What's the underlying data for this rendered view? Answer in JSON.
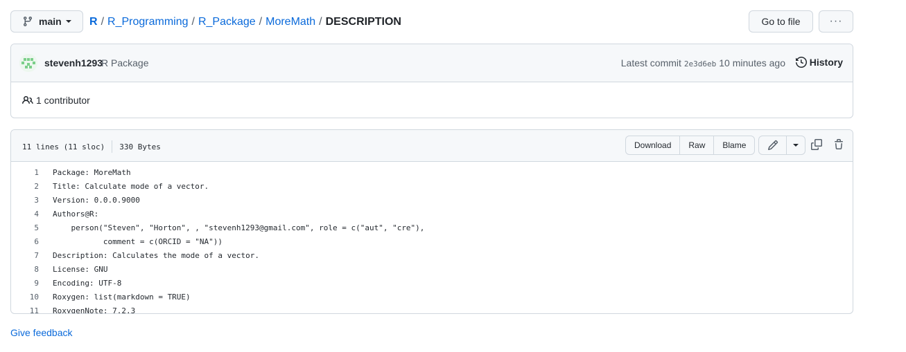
{
  "branch": {
    "label": "main"
  },
  "breadcrumb": {
    "items": [
      "R",
      "R_Programming",
      "R_Package",
      "MoreMath"
    ],
    "current": "DESCRIPTION",
    "separator": "/"
  },
  "toolbar": {
    "goto_label": "Go to file",
    "more_label": "···"
  },
  "commit": {
    "author": "stevenh1293",
    "message": "R Package",
    "latest_label": "Latest commit",
    "sha": "2e3d6eb",
    "time": "10 minutes ago",
    "history_label": "History"
  },
  "contributors": {
    "label": "1 contributor"
  },
  "file": {
    "lines_info": "11 lines (11 sloc)",
    "size": "330 Bytes",
    "buttons": {
      "download": "Download",
      "raw": "Raw",
      "blame": "Blame"
    },
    "lines": [
      "Package: MoreMath",
      "Title: Calculate mode of a vector.",
      "Version: 0.0.0.9000",
      "Authors@R:",
      "    person(\"Steven\", \"Horton\", , \"stevenh1293@gmail.com\", role = c(\"aut\", \"cre\"),",
      "           comment = c(ORCID = \"NA\"))",
      "Description: Calculates the mode of a vector.",
      "License: GNU",
      "Encoding: UTF-8",
      "Roxygen: list(markdown = TRUE)",
      "RoxygenNote: 7.2.3"
    ]
  },
  "feedback": {
    "label": "Give feedback"
  },
  "colors": {
    "link": "#0969da",
    "border": "#d0d7de",
    "header_bg": "#f6f8fa",
    "muted": "#57606a"
  }
}
